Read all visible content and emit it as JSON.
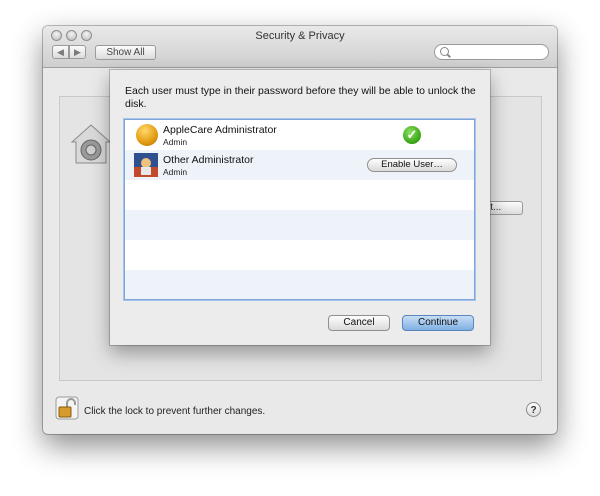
{
  "window": {
    "title": "Security & Privacy",
    "toolbar": {
      "back_icon": "back-arrow-icon",
      "forward_icon": "forward-arrow-icon",
      "show_all_label": "Show All"
    },
    "search": {
      "placeholder": "",
      "icon": "search-icon"
    },
    "background_button_label": "lt...",
    "footer_text": "Click the lock to prevent further changes.",
    "help_label": "?"
  },
  "sheet": {
    "message": "Each user must type in their password before they will be able to unlock the disk.",
    "users": [
      {
        "name": "AppleCare Administrator",
        "role": "Admin",
        "status": "enabled",
        "status_icon": "checkmark-icon"
      },
      {
        "name": "Other Administrator",
        "role": "Admin",
        "action_label": "Enable User…"
      }
    ],
    "cancel_label": "Cancel",
    "continue_label": "Continue"
  },
  "colors": {
    "accent_blue": "#7fb0e4",
    "check_green": "#35a312",
    "selection_border": "#7fa4d6"
  }
}
